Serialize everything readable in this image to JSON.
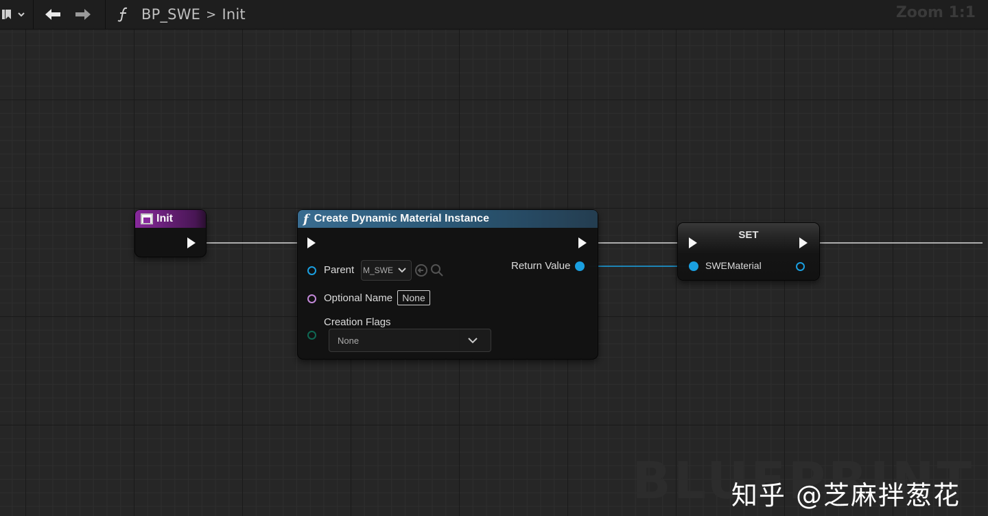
{
  "toolbar": {
    "breadcrumb_function_icon": "function-icon",
    "breadcrumb_blueprint": "BP_SWE",
    "breadcrumb_separator": ">",
    "breadcrumb_graph": "Init",
    "zoom_label": "Zoom 1:1"
  },
  "nodes": {
    "init": {
      "title": "Init",
      "header_color": "#7a1f8c"
    },
    "create_dmi": {
      "title": "Create Dynamic Material Instance",
      "function_glyph": "f",
      "header_color": "#2a5572",
      "pins": {
        "parent_label": "Parent",
        "parent_value": "M_SWE",
        "optional_name_label": "Optional Name",
        "optional_name_value": "None",
        "creation_flags_label": "Creation Flags",
        "creation_flags_value": "None",
        "return_value_label": "Return Value"
      }
    },
    "set": {
      "title": "SET",
      "variable_label": "SWEMaterial"
    }
  },
  "colors": {
    "object_pin": "#1aa3e6",
    "name_pin": "#c98de0",
    "enum_pin": "#0f6b55",
    "exec_pin": "#ffffff"
  },
  "watermark": {
    "text": "知乎 @芝麻拌葱花",
    "background_text": "BLUEPRINT"
  }
}
